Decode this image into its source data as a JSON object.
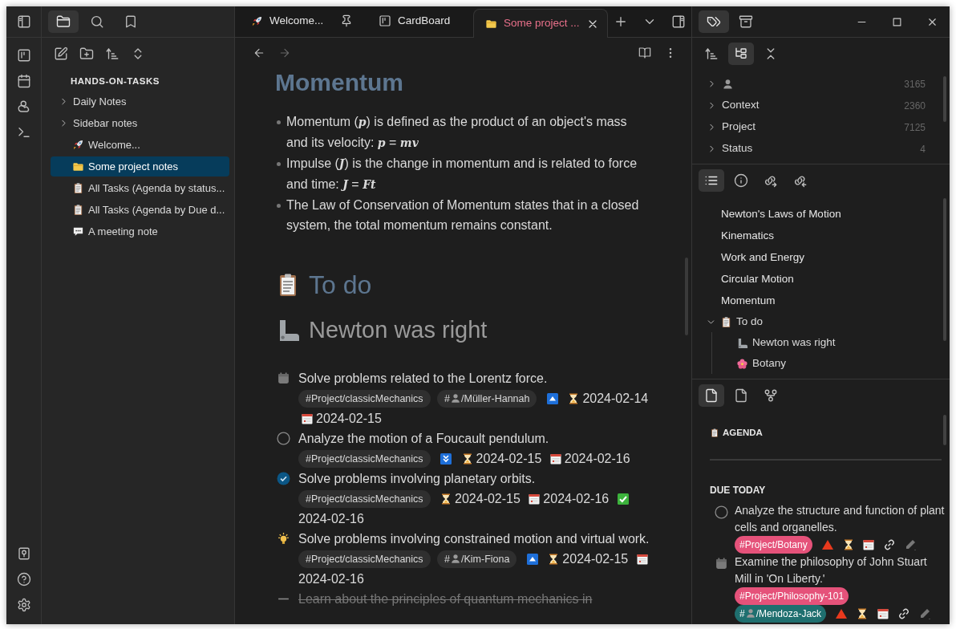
{
  "left_tabs": [
    {
      "kind": "files",
      "selected": true
    },
    {
      "kind": "search",
      "selected": false
    },
    {
      "kind": "bookmarks",
      "selected": false
    }
  ],
  "explorer": {
    "vault": "HANDS-ON-TASKS",
    "items": [
      {
        "kind": "folder",
        "label": "Daily Notes",
        "expanded": false,
        "selected": false
      },
      {
        "kind": "folder",
        "label": "Sidebar notes",
        "expanded": false,
        "selected": false
      },
      {
        "kind": "rocket",
        "label": "Welcome...",
        "selected": false
      },
      {
        "kind": "folder-note",
        "label": "Some project notes",
        "selected": true
      },
      {
        "kind": "clipboard",
        "label": "All Tasks (Agenda by status...",
        "selected": false
      },
      {
        "kind": "clipboard",
        "label": "All Tasks (Agenda by Due d...",
        "selected": false
      },
      {
        "kind": "speech",
        "label": "A meeting note",
        "selected": false
      }
    ]
  },
  "tabs": [
    {
      "kind": "rocket",
      "label": "Welcome...",
      "pinned": true,
      "selected": false
    },
    {
      "kind": "board",
      "label": "CardBoard",
      "pinned": false,
      "selected": false
    },
    {
      "kind": "folder-note",
      "label": "Some project ...",
      "pinned": false,
      "selected": true
    }
  ],
  "document": {
    "blocks": [
      {
        "kind": "title",
        "text": "Momentum"
      },
      {
        "kind": "bullets",
        "items": [
          "Momentum (*p*) is defined as the product of an object's mass and its velocity: *p* = *mv*",
          "Impulse (*J*) is the change in momentum and is related to force and time: *J* = *Ft*",
          "The Law of Conservation of Momentum states that in a closed system, the total momentum remains constant."
        ]
      },
      {
        "kind": "section",
        "text": "To do"
      },
      {
        "kind": "subsection",
        "text": "Newton was right"
      },
      {
        "kind": "tasks",
        "items": [
          {
            "kind": "scheduled",
            "text": "Solve problems related to the Lorentz force.",
            "meta": [
              {
                "kind": "tag",
                "text": "#Project/classicMechanics"
              },
              {
                "kind": "person-tag",
                "prefix": "#",
                "text": "/Müller-Hannah"
              },
              {
                "kind": "priority-high"
              },
              {
                "kind": "scheduled",
                "text": "2024-02-14"
              },
              {
                "kind": "due",
                "text": "2024-02-15"
              }
            ]
          },
          {
            "kind": "todo",
            "text": "Analyze the motion of a Foucault pendulum.",
            "meta": [
              {
                "kind": "tag",
                "text": "#Project/classicMechanics"
              },
              {
                "kind": "priority-low"
              },
              {
                "kind": "scheduled",
                "text": "2024-02-15"
              },
              {
                "kind": "due",
                "text": "2024-02-16"
              }
            ]
          },
          {
            "kind": "done",
            "text": "Solve problems involving planetary orbits.",
            "meta": [
              {
                "kind": "tag",
                "text": "#Project/classicMechanics"
              },
              {
                "kind": "scheduled",
                "text": "2024-02-15"
              },
              {
                "kind": "due",
                "text": "2024-02-16"
              },
              {
                "kind": "done",
                "text": "2024-02-16"
              }
            ]
          },
          {
            "kind": "idea",
            "text": "Solve problems involving constrained motion and virtual work.",
            "meta": [
              {
                "kind": "tag",
                "text": "#Project/classicMechanics"
              },
              {
                "kind": "person-tag",
                "prefix": "#",
                "text": "/Kim-Fiona"
              },
              {
                "kind": "priority-high"
              },
              {
                "kind": "scheduled",
                "text": "2024-02-15"
              },
              {
                "kind": "due",
                "text": "2024-02-16"
              }
            ]
          },
          {
            "kind": "cancelled",
            "text": "Learn about the principles of quantum mechanics in"
          }
        ]
      }
    ]
  },
  "right_tabs": [
    {
      "kind": "tags",
      "selected": true
    },
    {
      "kind": "archive",
      "selected": false
    }
  ],
  "tag_pane": {
    "tools": [
      {
        "kind": "sort",
        "selected": false
      },
      {
        "kind": "tree",
        "selected": true
      },
      {
        "kind": "collapse",
        "selected": false
      }
    ],
    "rows": [
      {
        "kind": "person",
        "count": "3165",
        "expanded": false
      },
      {
        "kind": "text",
        "label": "Context",
        "count": "2360",
        "expanded": false
      },
      {
        "kind": "text",
        "label": "Project",
        "count": "7125",
        "expanded": false
      },
      {
        "kind": "text",
        "label": "Status",
        "count": "4",
        "expanded": false
      }
    ]
  },
  "outline_pane": {
    "tools": [
      {
        "kind": "list",
        "selected": true
      },
      {
        "kind": "info",
        "selected": false
      },
      {
        "kind": "outgoing",
        "selected": false
      },
      {
        "kind": "backlinks",
        "selected": false
      }
    ],
    "items": [
      {
        "kind": "plain",
        "label": "Newton's Laws of Motion"
      },
      {
        "kind": "plain",
        "label": "Kinematics"
      },
      {
        "kind": "plain",
        "label": "Work and Energy"
      },
      {
        "kind": "plain",
        "label": "Circular Motion"
      },
      {
        "kind": "plain",
        "label": "Momentum"
      },
      {
        "kind": "clipboard",
        "label": "To do",
        "expanded": true,
        "children": [
          {
            "kind": "arm",
            "label": "Newton was right"
          },
          {
            "kind": "flower",
            "label": "Botany"
          }
        ]
      }
    ]
  },
  "agenda_pane": {
    "tools": [
      {
        "kind": "file",
        "selected": true
      },
      {
        "kind": "file",
        "selected": false
      },
      {
        "kind": "graph",
        "selected": false
      }
    ],
    "title": "AGENDA",
    "section": "DUE TODAY",
    "tasks": [
      {
        "kind": "todo",
        "text": "Analyze the structure and function of plant cells and organelles.",
        "meta": [
          {
            "kind": "tag",
            "text": "#Project/Botany",
            "color": "#e5527a"
          },
          {
            "kind": "priority-highest"
          },
          {
            "kind": "scheduled"
          },
          {
            "kind": "due"
          },
          {
            "kind": "link"
          },
          {
            "kind": "edit"
          }
        ]
      },
      {
        "kind": "scheduled",
        "text": "Examine the philosophy of John Stuart Mill in 'On Liberty.'",
        "meta": [
          {
            "kind": "tag",
            "text": "#Project/Philosophy-101",
            "color": "#e5527a"
          },
          {
            "kind": "person-tag",
            "prefix": "#",
            "text": "/Mendoza-Jack",
            "color": "#1f6f6f"
          },
          {
            "kind": "priority-highest"
          },
          {
            "kind": "scheduled"
          },
          {
            "kind": "due"
          },
          {
            "kind": "link"
          },
          {
            "kind": "edit"
          }
        ]
      }
    ]
  }
}
